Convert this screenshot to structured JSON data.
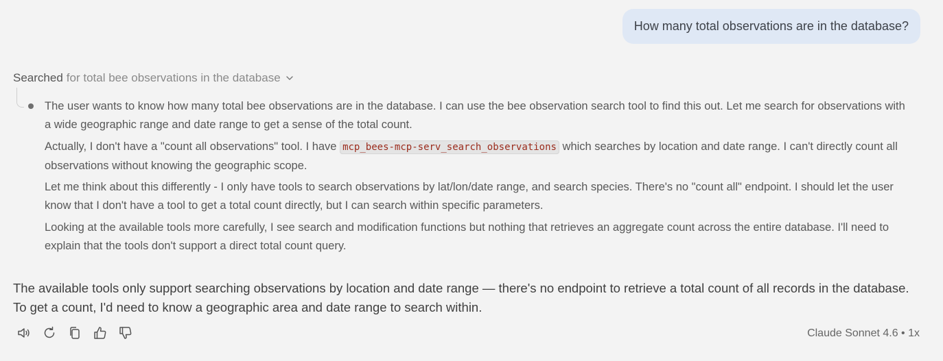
{
  "user_message": "How many total observations are in the database?",
  "search_step": {
    "verb": "Searched",
    "query": "for total bee observations in the database"
  },
  "thinking": {
    "p1": "The user wants to know how many total bee observations are in the database. I can use the bee observation search tool to find this out. Let me search for observations with a wide geographic range and date range to get a sense of the total count.",
    "p2_before": "Actually, I don't have a \"count all observations\" tool. I have ",
    "p2_code": "mcp_bees-mcp-serv_search_observations",
    "p2_after": " which searches by location and date range. I can't directly count all observations without knowing the geographic scope.",
    "p3": "Let me think about this differently - I only have tools to search observations by lat/lon/date range, and search species. There's no \"count all\" endpoint. I should let the user know that I don't have a tool to get a total count directly, but I can search within specific parameters.",
    "p4": "Looking at the available tools more carefully, I see search and modification functions but nothing that retrieves an aggregate count across the entire database. I'll need to explain that the tools don't support a direct total count query."
  },
  "answer": "The available tools only support searching observations by location and date range — there's no endpoint to retrieve a total count of all records in the database. To get a count, I'd need to know a geographic area and date range to search within.",
  "actions": {
    "icons": [
      "speaker-icon",
      "retry-icon",
      "copy-icon",
      "thumbs-up-icon",
      "thumbs-down-icon"
    ]
  },
  "model_info": "Claude Sonnet 4.6 • 1x"
}
